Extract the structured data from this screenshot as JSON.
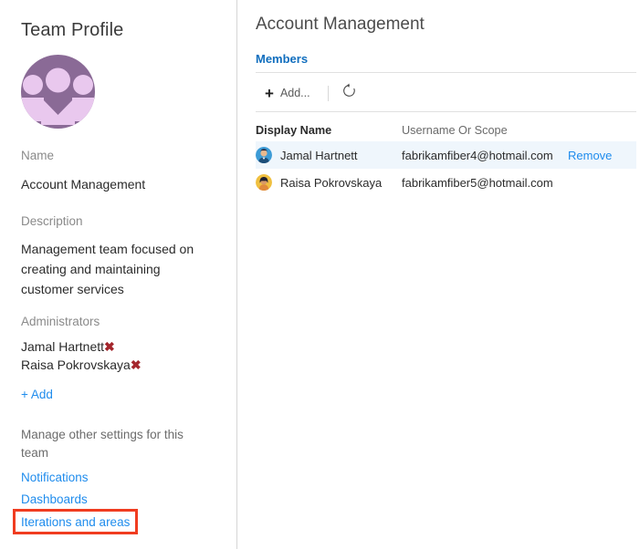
{
  "sidebar": {
    "title": "Team Profile",
    "avatar_icon": "team-group-avatar",
    "avatar_bg_color": "#8a6a96",
    "avatar_fg_color": "#e9c8ee",
    "name_label": "Name",
    "name_value": "Account Management",
    "description_label": "Description",
    "description_value": "Management team focused on creating and maintaining customer services",
    "administrators_label": "Administrators",
    "administrators": [
      {
        "name": "Jamal Hartnett",
        "remove_icon": "x-remove-icon"
      },
      {
        "name": "Raisa Pokrovskaya",
        "remove_icon": "x-remove-icon"
      }
    ],
    "add_admin_plus": "+",
    "add_admin_label": "Add",
    "manage_note": "Manage other settings for this team",
    "settings_links": [
      "Notifications",
      "Dashboards",
      "Iterations and areas"
    ],
    "highlighted_link": "Iterations and areas",
    "highlight_color": "#f03c20",
    "link_color": "#1f8ced",
    "admin_x_color": "#a4262c"
  },
  "content": {
    "title": "Account Management",
    "tab_label": "Members",
    "tab_color": "#106ebe",
    "toolbar": {
      "add_plus": "+",
      "add_label": "Add...",
      "refresh_icon": "refresh-icon"
    },
    "table": {
      "columns": [
        "Display Name",
        "Username Or Scope"
      ],
      "action_label": "Remove",
      "rows": [
        {
          "avatar_icon": "user-avatar-blue",
          "avatar_bg": "#3c9bd6",
          "display_name": "Jamal Hartnett",
          "username": "fabrikamfiber4@hotmail.com",
          "action": "Remove",
          "selected": true
        },
        {
          "avatar_icon": "user-avatar-yellow",
          "avatar_bg": "#f0c040",
          "display_name": "Raisa Pokrovskaya",
          "username": "fabrikamfiber5@hotmail.com",
          "action": "",
          "selected": false
        }
      ]
    }
  }
}
